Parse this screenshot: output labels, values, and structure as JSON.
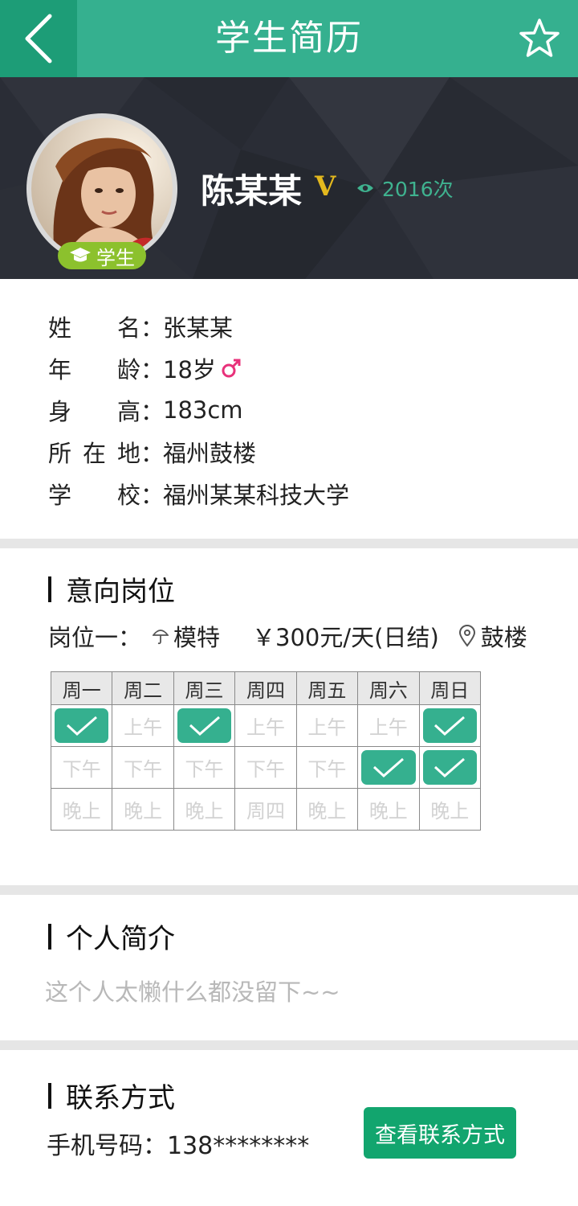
{
  "header": {
    "title": "学生简历",
    "back_icon": "chevron-left-icon",
    "favorite_icon": "star-outline-icon"
  },
  "profile": {
    "name": "陈某某",
    "vip_mark": "V",
    "views": "2016次",
    "role_badge": "学生"
  },
  "info": {
    "rows": [
      {
        "label": [
          "姓",
          "名"
        ],
        "value": "张某某"
      },
      {
        "label": [
          "年",
          "龄"
        ],
        "value": "18岁"
      },
      {
        "label": [
          "身",
          "高"
        ],
        "value": "183cm"
      },
      {
        "label": [
          "所",
          "在",
          "地"
        ],
        "value": "福州鼓楼"
      },
      {
        "label": [
          "学",
          "校"
        ],
        "value": "福州某某科技大学"
      }
    ],
    "colon": "："
  },
  "job": {
    "section_title": "意向岗位",
    "label": "岗位一：",
    "position": "模特",
    "salary": "￥300元/天(日结)",
    "location": "鼓楼"
  },
  "schedule": {
    "days": [
      "周一",
      "周二",
      "周三",
      "周四",
      "周五",
      "周六",
      "周日"
    ],
    "rows": [
      [
        "✓",
        "上午",
        "✓",
        "上午",
        "上午",
        "上午",
        "✓"
      ],
      [
        "下午",
        "下午",
        "下午",
        "下午",
        "下午",
        "✓",
        "✓"
      ],
      [
        "晚上",
        "晚上",
        "晚上",
        "周四",
        "晚上",
        "晚上",
        "晚上"
      ]
    ]
  },
  "intro": {
    "section_title": "个人简介",
    "text": "这个人太懒什么都没留下~~"
  },
  "contact": {
    "section_title": "联系方式",
    "phone_label": "手机号码：",
    "phone_value": "138********",
    "button_label": "查看联系方式"
  },
  "colors": {
    "accent": "#35b08f",
    "back_button": "#1d9d77",
    "badge": "#8cc12d",
    "vip": "#e3b81e",
    "contact_button": "#12a56e",
    "female_icon": "#e8317a"
  }
}
